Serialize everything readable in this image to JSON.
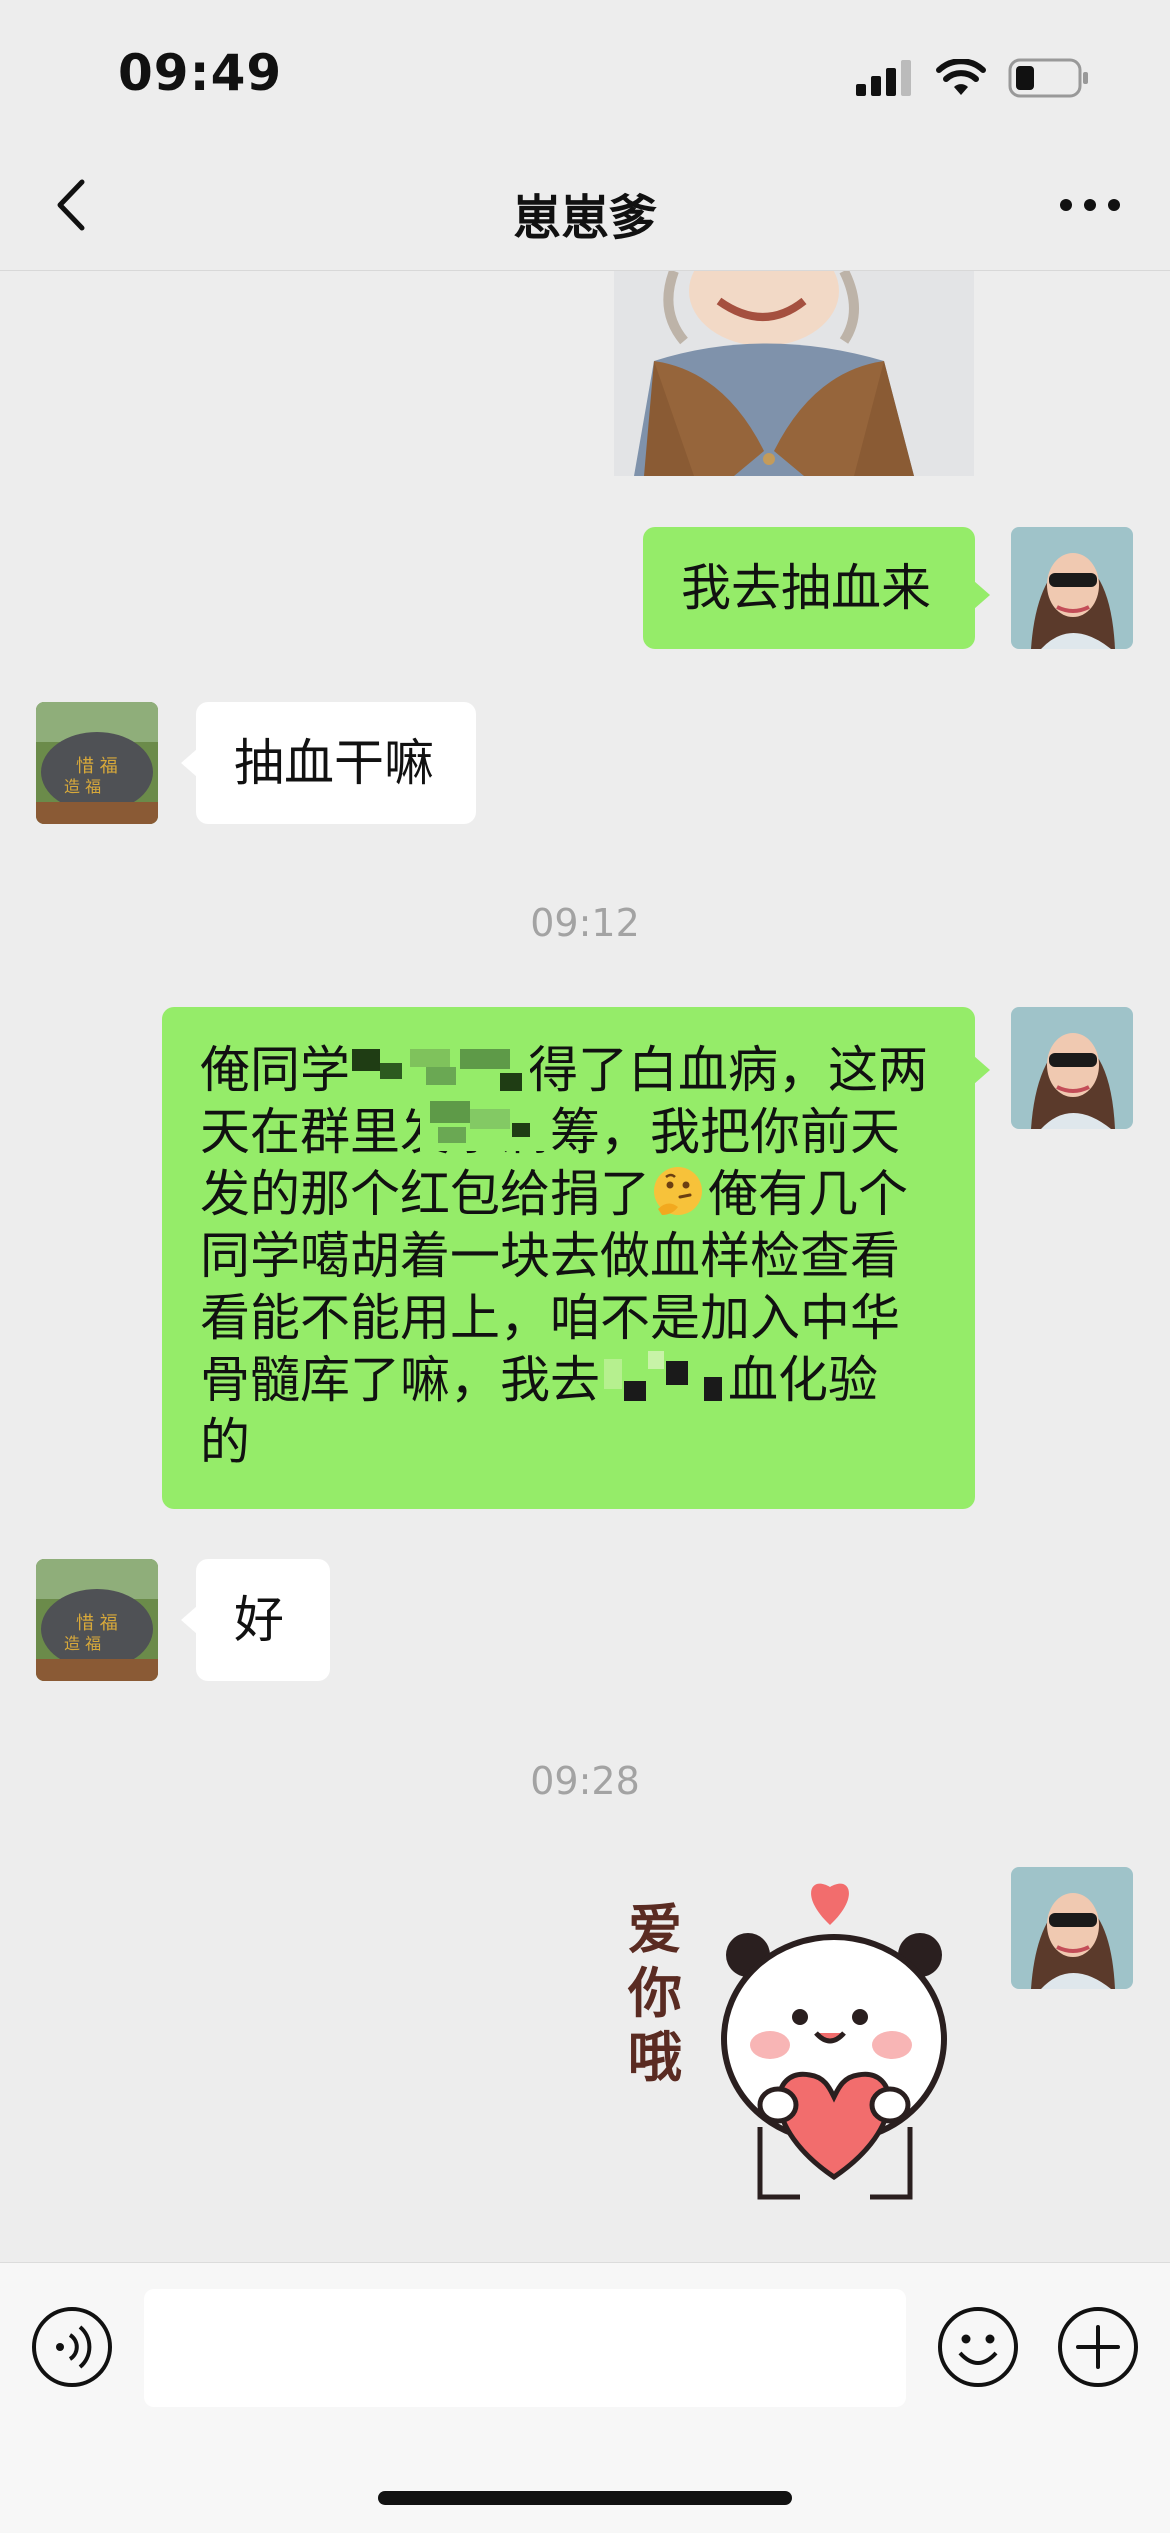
{
  "status": {
    "time": "09:49"
  },
  "header": {
    "title": "崽崽爹"
  },
  "messages": [
    {
      "side": "right",
      "text": "我去抽血来"
    },
    {
      "side": "left",
      "text": "抽血干嘛"
    },
    {
      "side": "right",
      "lines": [
        "俺同学",
        "得了白血病，这两",
        "天在群里发水滴筹，我把你前天",
        "发的那个红包给捐了",
        "俺有几个",
        "同学噶胡着一块去做血样检查看",
        "看能不能用上，咱不是加入中华",
        "骨髓库了嘛，我去",
        "血化验",
        "的"
      ]
    },
    {
      "side": "left",
      "text": "好"
    },
    {
      "side": "right",
      "sticker_text": "爱你哦"
    }
  ],
  "timestamps": [
    "09:12",
    "09:28"
  ],
  "colors": {
    "bubble_green": "#95ec69",
    "bubble_white": "#ffffff",
    "background": "#ededed",
    "timestamp": "#a3a3a3"
  }
}
